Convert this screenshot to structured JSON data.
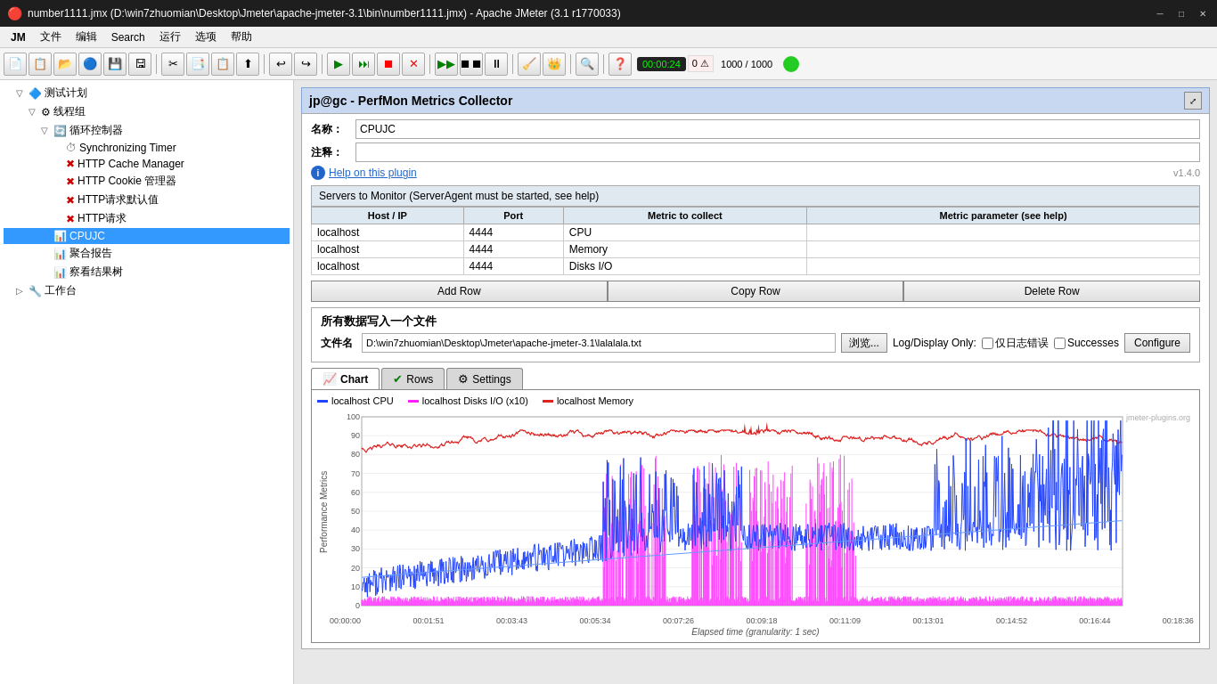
{
  "titlebar": {
    "title": "number1111.jmx (D:\\win7zhuomian\\Desktop\\Jmeter\\apache-jmeter-3.1\\bin\\number1111.jmx) - Apache JMeter (3.1 r1770033)"
  },
  "menubar": {
    "app_label": "JM",
    "items": [
      "文件",
      "编辑",
      "Search",
      "运行",
      "选项",
      "帮助"
    ]
  },
  "toolbar": {
    "timer_label": "00:00:24",
    "errors_label": "0",
    "samples_label": "1000 / 1000"
  },
  "tree": {
    "items": [
      {
        "id": "test-plan",
        "label": "测试计划",
        "indent": 0,
        "icon": "🔷",
        "expand": "▽"
      },
      {
        "id": "thread-group",
        "label": "线程组",
        "indent": 1,
        "icon": "⚙",
        "expand": "▽"
      },
      {
        "id": "loop-ctrl",
        "label": "循环控制器",
        "indent": 2,
        "icon": "🔄",
        "expand": "▽"
      },
      {
        "id": "sync-timer",
        "label": "Synchronizing Timer",
        "indent": 3,
        "icon": "⏱",
        "expand": ""
      },
      {
        "id": "http-cache",
        "label": "HTTP Cache Manager",
        "indent": 3,
        "icon": "✖",
        "expand": ""
      },
      {
        "id": "http-cookie",
        "label": "HTTP Cookie 管理器",
        "indent": 3,
        "icon": "✖",
        "expand": ""
      },
      {
        "id": "http-default",
        "label": "HTTP请求默认值",
        "indent": 3,
        "icon": "✖",
        "expand": ""
      },
      {
        "id": "http-req",
        "label": "HTTP请求",
        "indent": 3,
        "icon": "✖",
        "expand": ""
      },
      {
        "id": "cpujc",
        "label": "CPUJC",
        "indent": 2,
        "icon": "📊",
        "expand": "",
        "selected": true
      },
      {
        "id": "summary",
        "label": "聚合报告",
        "indent": 2,
        "icon": "📊",
        "expand": ""
      },
      {
        "id": "view-results",
        "label": "察看结果树",
        "indent": 2,
        "icon": "📊",
        "expand": ""
      },
      {
        "id": "workbench",
        "label": "工作台",
        "indent": 0,
        "icon": "🔧",
        "expand": ""
      }
    ]
  },
  "panel": {
    "title": "jp@gc - PerfMon Metrics Collector",
    "name_label": "名称：",
    "name_value": "CPUJC",
    "comment_label": "注释：",
    "comment_value": "",
    "help_text": "Help on this plugin",
    "version": "v1.4.0",
    "servers_header": "Servers to Monitor (ServerAgent must be started, see help)",
    "servers_cols": [
      "Host / IP",
      "Port",
      "Metric to collect",
      "Metric parameter (see help)"
    ],
    "servers_rows": [
      {
        "host": "localhost",
        "port": "4444",
        "metric": "CPU",
        "param": ""
      },
      {
        "host": "localhost",
        "port": "4444",
        "metric": "Memory",
        "param": ""
      },
      {
        "host": "localhost",
        "port": "4444",
        "metric": "Disks I/O",
        "param": ""
      }
    ],
    "btn_add": "Add Row",
    "btn_copy": "Copy Row",
    "btn_delete": "Delete Row",
    "file_section_title": "所有数据写入一个文件",
    "file_label": "文件名",
    "file_value": "D:\\win7zhuomian\\Desktop\\Jmeter\\apache-jmeter-3.1\\lalalala.txt",
    "file_browse_btn": "浏览...",
    "log_display_label": "Log/Display Only:",
    "checkbox_errors_label": "仅日志错误",
    "checkbox_successes_label": "Successes",
    "configure_btn": "Configure",
    "tabs": [
      {
        "id": "chart",
        "label": "Chart",
        "icon": "📈",
        "active": true
      },
      {
        "id": "rows",
        "label": "Rows",
        "icon": "✔",
        "active": false
      },
      {
        "id": "settings",
        "label": "Settings",
        "icon": "⚙",
        "active": false
      }
    ],
    "chart": {
      "watermark": "jmeter-plugins.org",
      "legend": [
        {
          "color": "#2244ff",
          "label": "localhost CPU"
        },
        {
          "color": "#ff22ff",
          "label": "localhost Disks I/O (x10)"
        },
        {
          "color": "#dd2222",
          "label": "localhost Memory"
        }
      ],
      "y_label": "Performance Metrics",
      "y_ticks": [
        100,
        90,
        80,
        70,
        60,
        50,
        40,
        30,
        20,
        10,
        0
      ],
      "x_labels": [
        "00:00:00",
        "00:01:51",
        "00:03:43",
        "00:05:34",
        "00:07:26",
        "00:09:18",
        "00:11:09",
        "00:13:01",
        "00:14:52",
        "00:16:44",
        "00:18:36"
      ],
      "x_title": "Elapsed time (granularity: 1 sec)"
    }
  }
}
